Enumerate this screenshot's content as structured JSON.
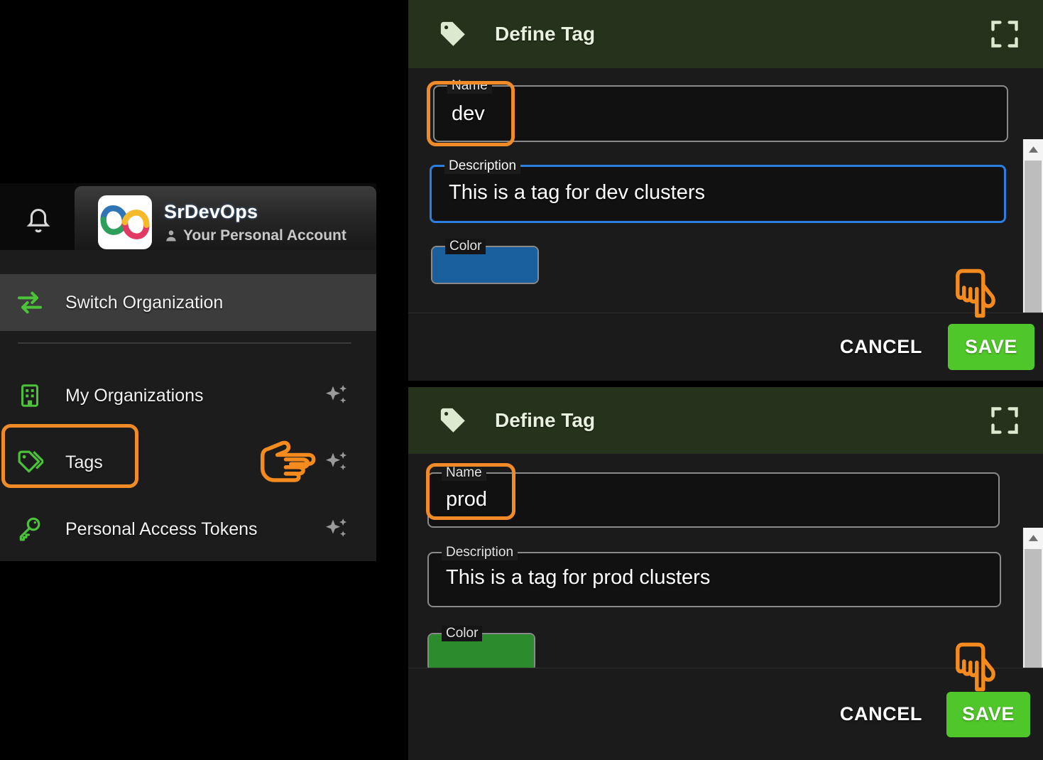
{
  "account": {
    "name": "SrDevOps",
    "subtitle": "Your Personal Account",
    "bell_icon": "bell-icon",
    "person_icon": "person-icon",
    "logo_icon": "devops-infinity-logo"
  },
  "menu": {
    "items": [
      {
        "label": "Switch Organization",
        "icon": "switch-arrows-icon",
        "sparkle": false,
        "selected": true
      },
      {
        "label": "My Organizations",
        "icon": "building-icon",
        "sparkle": true,
        "selected": false
      },
      {
        "label": "Tags",
        "icon": "tag-icon",
        "sparkle": true,
        "selected": false,
        "highlighted": true
      },
      {
        "label": "Personal Access Tokens",
        "icon": "key-icon",
        "sparkle": true,
        "selected": false
      }
    ]
  },
  "annotations": {
    "highlight_color": "#f08b28",
    "pointer_right": "pointing-hand-right",
    "pointer_down": "pointing-hand-down"
  },
  "dialogs": [
    {
      "title": "Define Tag",
      "tag_icon": "tag-icon",
      "expand_icon": "fullscreen-icon",
      "fields": {
        "name_label": "Name",
        "name_value": "dev",
        "description_label": "Description",
        "description_value": "This is a tag for dev clusters",
        "color_label": "Color",
        "color_value": "#1a5f9e"
      },
      "cancel_label": "CANCEL",
      "save_label": "SAVE",
      "save_color": "#4fc629"
    },
    {
      "title": "Define Tag",
      "tag_icon": "tag-icon",
      "expand_icon": "fullscreen-icon",
      "fields": {
        "name_label": "Name",
        "name_value": "prod",
        "description_label": "Description",
        "description_value": "This is a tag for prod clusters",
        "color_label": "Color",
        "color_value": "#2c8b2c"
      },
      "cancel_label": "CANCEL",
      "save_label": "SAVE",
      "save_color": "#4fc629"
    }
  ]
}
